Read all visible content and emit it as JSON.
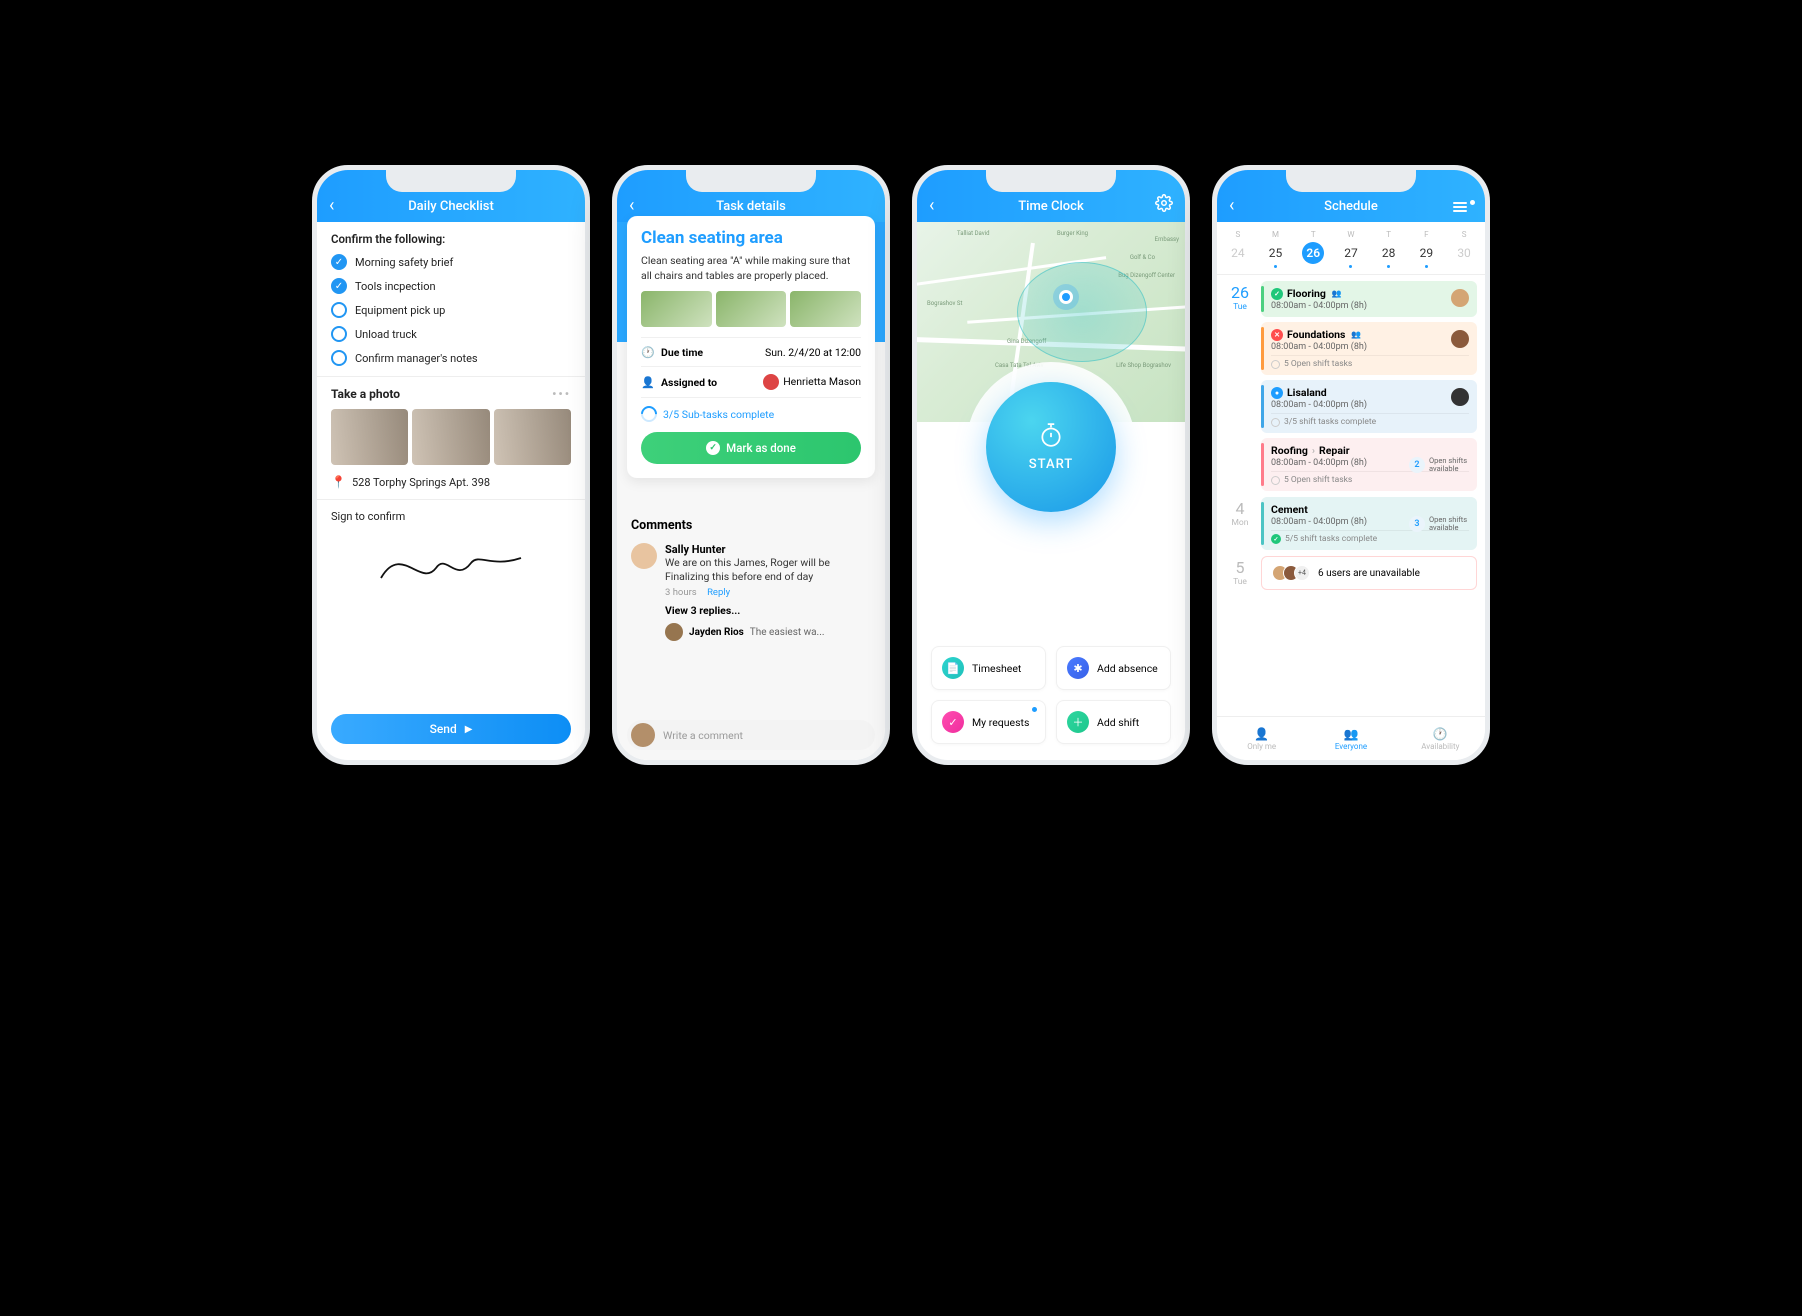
{
  "phone1": {
    "header_title": "Daily Checklist",
    "confirm_label": "Confirm the following:",
    "items": [
      {
        "label": "Morning safety brief",
        "done": true
      },
      {
        "label": "Tools incpection",
        "done": true
      },
      {
        "label": "Equipment pick up",
        "done": false
      },
      {
        "label": "Unload truck",
        "done": false
      },
      {
        "label": "Confirm manager's notes",
        "done": false
      }
    ],
    "photo_section_title": "Take a photo",
    "address": "528 Torphy Springs Apt. 398",
    "sign_label": "Sign to confirm",
    "send_label": "Send"
  },
  "phone2": {
    "header_title": "Task details",
    "task_title": "Clean seating area",
    "task_desc": "Clean seating area \"A\" while making sure that all chairs and tables are properly placed.",
    "due_label": "Due time",
    "due_value": "Sun. 2/4/20 at 12:00",
    "assigned_label": "Assigned to",
    "assigned_value": "Henrietta Mason",
    "subtasks_text": "3/5 Sub-tasks complete",
    "done_label": "Mark as done",
    "comments_title": "Comments",
    "comment": {
      "name": "Sally Hunter",
      "text": "We are on this James, Roger will be Finalizing  this before end of day",
      "ago": "3 hours",
      "reply": "Reply"
    },
    "view_replies": "View 3 replies...",
    "reply1_name": "Jayden Rios",
    "reply1_text": "The easiest wa...",
    "composer_placeholder": "Write a comment"
  },
  "phone3": {
    "header_title": "Time Clock",
    "start_label": "START",
    "map_labels": [
      "Talliat David",
      "Burger King",
      "Embassy",
      "Golf & Co",
      "Bug Dizengoff Center",
      "Bograshov St",
      "Gina Dizengoff",
      "Casa Tata Tel Aviv",
      "Life Shop Bograshov"
    ],
    "tiles": [
      {
        "label": "Timesheet",
        "icon": "timesheet"
      },
      {
        "label": "Add absence",
        "icon": "absence"
      },
      {
        "label": "My requests",
        "icon": "requests",
        "dot": true
      },
      {
        "label": "Add shift",
        "icon": "addshift"
      }
    ]
  },
  "phone4": {
    "header_title": "Schedule",
    "week": [
      {
        "dow": "S",
        "num": "24",
        "muted": true,
        "dot": false
      },
      {
        "dow": "M",
        "num": "25",
        "dot": true
      },
      {
        "dow": "T",
        "num": "26",
        "active": true,
        "dot": false
      },
      {
        "dow": "W",
        "num": "27",
        "dot": true
      },
      {
        "dow": "T",
        "num": "28",
        "dot": true
      },
      {
        "dow": "F",
        "num": "29",
        "dot": true
      },
      {
        "dow": "S",
        "num": "30",
        "muted": true,
        "dot": false
      }
    ],
    "day26": {
      "num": "26",
      "dow": "Tue"
    },
    "day4": {
      "num": "4",
      "dow": "Mon"
    },
    "day5": {
      "num": "5",
      "dow": "Tue"
    },
    "shifts26": [
      {
        "title": "Flooring",
        "time": "08:00am - 04:00pm (8h)",
        "status": "green",
        "people": true
      },
      {
        "title": "Foundations",
        "time": "08:00am - 04:00pm (8h)",
        "status": "red",
        "people": true,
        "subline": "5 Open shift tasks"
      },
      {
        "title": "Lisaland",
        "time": "08:00am - 04:00pm (8h)",
        "status": "blue",
        "subline": "3/5 shift tasks complete"
      }
    ],
    "shift_roofing": {
      "title": "Roofing",
      "sub": "Repair",
      "time": "08:00am - 04:00pm (8h)",
      "open_count": "2",
      "open_label": "Open shifts available",
      "subline": "5 Open shift tasks"
    },
    "shift_cement": {
      "title": "Cement",
      "time": "08:00am - 04:00pm (8h)",
      "open_count": "3",
      "open_label": "Open shifts available",
      "subline": "5/5 shift tasks complete"
    },
    "unavailable": {
      "count": "+4",
      "text": "6 users are unavailable"
    },
    "tabs": [
      {
        "label": "Only me",
        "icon": "person"
      },
      {
        "label": "Everyone",
        "icon": "people",
        "active": true
      },
      {
        "label": "Availability",
        "icon": "clock"
      }
    ]
  }
}
